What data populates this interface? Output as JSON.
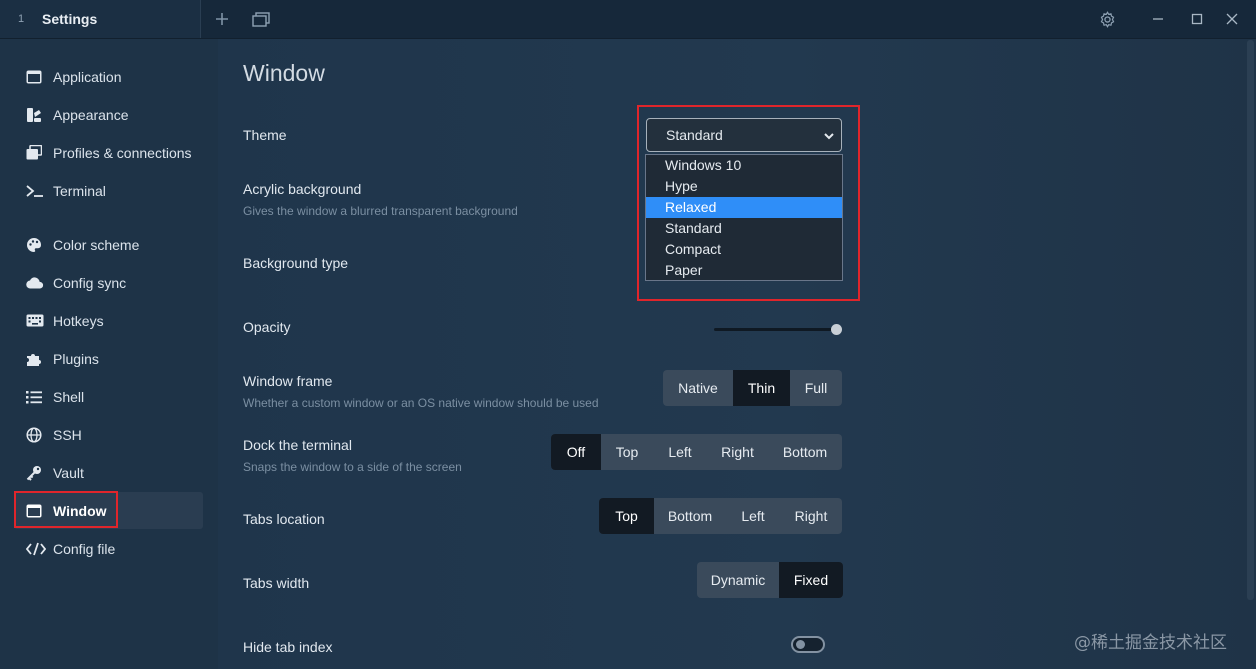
{
  "titlebar": {
    "tab_index": "1",
    "tab_title": "Settings",
    "icons": [
      "plus-icon",
      "window-icon",
      "gear-icon",
      "minimize-icon",
      "maximize-icon",
      "close-icon"
    ]
  },
  "sidebar": {
    "items": [
      {
        "label": "Application",
        "icon": "window-icon"
      },
      {
        "label": "Appearance",
        "icon": "palette-icon"
      },
      {
        "label": "Profiles & connections",
        "icon": "window-stack-icon"
      },
      {
        "label": "Terminal",
        "icon": "terminal-icon"
      },
      {
        "label": "Color scheme",
        "icon": "palette-icon"
      },
      {
        "label": "Config sync",
        "icon": "cloud-icon"
      },
      {
        "label": "Hotkeys",
        "icon": "keyboard-icon"
      },
      {
        "label": "Plugins",
        "icon": "puzzle-icon"
      },
      {
        "label": "Shell",
        "icon": "list-icon"
      },
      {
        "label": "SSH",
        "icon": "globe-icon"
      },
      {
        "label": "Vault",
        "icon": "key-icon"
      },
      {
        "label": "Window",
        "icon": "window-icon",
        "active": true
      },
      {
        "label": "Config file",
        "icon": "code-icon"
      }
    ]
  },
  "main": {
    "title": "Window",
    "theme": {
      "label": "Theme",
      "value": "Standard",
      "options": [
        "Windows 10",
        "Hype",
        "Relaxed",
        "Standard",
        "Compact",
        "Paper"
      ],
      "highlighted": "Relaxed"
    },
    "acrylic": {
      "label": "Acrylic background",
      "description": "Gives the window a blurred transparent background"
    },
    "background_type": {
      "label": "Background type"
    },
    "opacity": {
      "label": "Opacity",
      "value": 1.0
    },
    "window_frame": {
      "label": "Window frame",
      "description": "Whether a custom window or an OS native window should be used",
      "options": [
        "Native",
        "Thin",
        "Full"
      ],
      "selected": "Thin"
    },
    "dock": {
      "label": "Dock the terminal",
      "description": "Snaps the window to a side of the screen",
      "options": [
        "Off",
        "Top",
        "Left",
        "Right",
        "Bottom"
      ],
      "selected": "Off"
    },
    "tabs_location": {
      "label": "Tabs location",
      "options": [
        "Top",
        "Bottom",
        "Left",
        "Right"
      ],
      "selected": "Top"
    },
    "tabs_width": {
      "label": "Tabs width",
      "options": [
        "Dynamic",
        "Fixed"
      ],
      "selected": "Fixed"
    },
    "hide_tab_index": {
      "label": "Hide tab index",
      "enabled": false
    }
  },
  "watermark": "@稀土掘金技术社区",
  "colors": {
    "accent": "#2f8ef8",
    "highlight_box": "#e0252b",
    "background": "#1d3146"
  }
}
